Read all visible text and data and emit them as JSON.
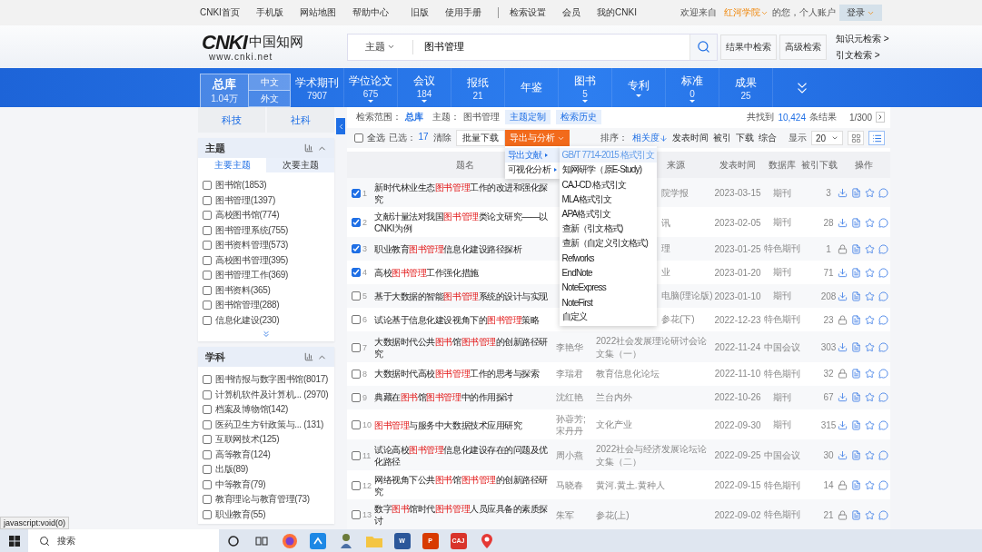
{
  "top_links": {
    "left": [
      "CNKI首页",
      "手机版",
      "网站地图",
      "帮助中心"
    ],
    "right": [
      "旧版",
      "使用手册",
      "检索设置",
      "会员",
      "我的CNKI"
    ],
    "welcome": "欢迎来自",
    "org": "红河学院",
    "greeting": "的您，个人账户",
    "login": "登录"
  },
  "header": {
    "logo": {
      "mark": "CNKI",
      "name": "中国知网",
      "url": "www.cnki.net"
    },
    "field_select": "主题",
    "query": "图书管理",
    "buttons": [
      "结果中检索",
      "高级检索"
    ],
    "links": [
      "知识元检索 >",
      "引文检索 >"
    ]
  },
  "nav": {
    "main": {
      "label": "总库",
      "count": "1.04万",
      "selected": true
    },
    "lang": [
      {
        "label": "中文",
        "selected": true
      },
      {
        "label": "外文",
        "selected": false
      }
    ],
    "tabs": [
      {
        "label": "学术期刊",
        "count": "7907",
        "dropdown": false
      },
      {
        "label": "学位论文",
        "count": "675",
        "dropdown": true
      },
      {
        "label": "会议",
        "count": "184",
        "dropdown": true
      },
      {
        "label": "报纸",
        "count": "21",
        "dropdown": false
      },
      {
        "label": "年鉴",
        "dropdown": false
      },
      {
        "label": "图书",
        "count": "5",
        "dropdown": true
      },
      {
        "label": "专利",
        "dropdown": true
      },
      {
        "label": "标准",
        "count": "0",
        "dropdown": true
      },
      {
        "label": "成果",
        "count": "25",
        "dropdown": false
      }
    ]
  },
  "sidebar": {
    "domains": [
      "科技",
      "社科"
    ],
    "panels": [
      {
        "title": "主题",
        "subtabs": [
          {
            "label": "主要主题",
            "selected": true
          },
          {
            "label": "次要主题",
            "selected": false
          }
        ],
        "more": true,
        "items": [
          {
            "label": "图书馆(1853)",
            "checked": false
          },
          {
            "label": "图书管理(1397)",
            "checked": false
          },
          {
            "label": "高校图书馆(774)",
            "checked": false
          },
          {
            "label": "图书管理系统(755)",
            "checked": false
          },
          {
            "label": "图书资料管理(573)",
            "checked": false
          },
          {
            "label": "高校图书管理(395)",
            "checked": false
          },
          {
            "label": "图书管理工作(369)",
            "checked": false
          },
          {
            "label": "图书资料(365)",
            "checked": false
          },
          {
            "label": "图书馆管理(288)",
            "checked": false
          },
          {
            "label": "信息化建设(230)",
            "checked": false
          }
        ]
      },
      {
        "title": "学科",
        "more": false,
        "items": [
          {
            "label": "图书情报与数字图书馆(8017)",
            "checked": false
          },
          {
            "label": "计算机软件及计算机...  (2970)",
            "checked": false
          },
          {
            "label": "档案及博物馆(142)",
            "checked": false
          },
          {
            "label": "医药卫生方针政策与...  (131)",
            "checked": false
          },
          {
            "label": "互联网技术(125)",
            "checked": false
          },
          {
            "label": "高等教育(124)",
            "checked": false
          },
          {
            "label": "出版(89)",
            "checked": false
          },
          {
            "label": "中等教育(79)",
            "checked": false
          },
          {
            "label": "教育理论与教育管理(73)",
            "checked": false
          },
          {
            "label": "职业教育(55)",
            "checked": false
          }
        ]
      }
    ]
  },
  "scope": {
    "label": "检索范围：",
    "value": "总库",
    "topic_label": "主题：",
    "topic": "图书管理",
    "buttons": [
      "主题定制",
      "检索历史"
    ],
    "found": "共找到",
    "total": "10,424",
    "unit": "条结果",
    "page": "1/300"
  },
  "toolbar": {
    "select_all": {
      "label": "全选",
      "checked": false
    },
    "selected_label": "已选：",
    "selected_count": "17",
    "clear": "清除",
    "batch": "批量下载",
    "export": "导出与分析",
    "sort_label": "排序：",
    "sorts": [
      {
        "label": "相关度",
        "selected": true
      },
      {
        "label": "发表时间",
        "selected": false
      },
      {
        "label": "被引",
        "selected": false
      },
      {
        "label": "下载",
        "selected": false
      },
      {
        "label": "综合",
        "selected": false
      }
    ],
    "show_label": "显示",
    "page_size": "20",
    "views": [
      {
        "kind": "grid",
        "selected": false
      },
      {
        "kind": "list",
        "selected": true
      }
    ]
  },
  "export_menu": {
    "groups": [
      {
        "label": "导出文献",
        "selected": true
      },
      {
        "label": "可视化分析",
        "selected": false
      }
    ],
    "formats": [
      {
        "label": "GB/T 7714-2015 格式引文",
        "selected": true
      },
      {
        "label": "知网研学（原E-Study)",
        "selected": false
      },
      {
        "label": "CAJ-CD 格式引文",
        "selected": false
      },
      {
        "label": "MLA格式引文",
        "selected": false
      },
      {
        "label": "APA格式引文",
        "selected": false
      },
      {
        "label": "查新（引文格式)",
        "selected": false
      },
      {
        "label": "查新（自定义引文格式)",
        "selected": false
      },
      {
        "label": "Refworks",
        "selected": false
      },
      {
        "label": "EndNote",
        "selected": false
      },
      {
        "label": "NoteExpress",
        "selected": false
      },
      {
        "label": "NoteFirst",
        "selected": false
      },
      {
        "label": "自定义",
        "selected": false
      }
    ]
  },
  "table": {
    "columns": [
      "题名",
      "来源",
      "发表时间",
      "数据库",
      "被引",
      "下载",
      "操作"
    ],
    "rows": [
      {
        "num": "1",
        "checked": true,
        "title": [
          {
            "text": "新时代林业生态",
            "hit": false
          },
          {
            "text": "图书管理",
            "hit": true
          },
          {
            "text": "工作的改进和强化探究",
            "hit": false
          }
        ],
        "source": "院学报",
        "date": "2023-03-15",
        "db": "期刊",
        "downloads": "3",
        "locked": false
      },
      {
        "num": "2",
        "checked": true,
        "title": [
          {
            "text": "文献计量法对我国",
            "hit": false
          },
          {
            "text": "图书管理",
            "hit": true
          },
          {
            "text": "类论文研究——以CNKI为例",
            "hit": false
          }
        ],
        "source": "讯",
        "date": "2023-02-05",
        "db": "期刊",
        "downloads": "28",
        "locked": false
      },
      {
        "num": "3",
        "checked": true,
        "title": [
          {
            "text": "职业教育",
            "hit": false
          },
          {
            "text": "图书管理",
            "hit": true
          },
          {
            "text": "信息化建设路径探析",
            "hit": false
          }
        ],
        "source": "理",
        "date": "2023-01-25",
        "db": "特色期刊",
        "downloads": "1",
        "locked": true
      },
      {
        "num": "4",
        "checked": true,
        "title": [
          {
            "text": "高校",
            "hit": false
          },
          {
            "text": "图书管理",
            "hit": true
          },
          {
            "text": "工作强化措施",
            "hit": false
          }
        ],
        "source": "业",
        "date": "2023-01-20",
        "db": "期刊",
        "downloads": "71",
        "locked": false
      },
      {
        "num": "5",
        "checked": false,
        "title": [
          {
            "text": "基于大数据的智能",
            "hit": false
          },
          {
            "text": "图书管理",
            "hit": true
          },
          {
            "text": "系统的设计与实现",
            "hit": false
          }
        ],
        "source": "电脑(理论版)",
        "date": "2023-01-10",
        "db": "期刊",
        "downloads": "208",
        "locked": false
      },
      {
        "num": "6",
        "checked": false,
        "title": [
          {
            "text": "试论基于信息化建设视角下的",
            "hit": false
          },
          {
            "text": "图书管理",
            "hit": true
          },
          {
            "text": "策略",
            "hit": false
          }
        ],
        "source": "参花(下)",
        "date": "2022-12-23",
        "db": "特色期刊",
        "downloads": "23",
        "locked": true
      },
      {
        "num": "7",
        "checked": false,
        "title": [
          {
            "text": "大数据时代公共",
            "hit": false
          },
          {
            "text": "图书",
            "hit": true
          },
          {
            "text": "馆",
            "hit": false
          },
          {
            "text": "图书管理",
            "hit": true
          },
          {
            "text": "的创新路径研究",
            "hit": false
          }
        ],
        "author": "李艳华",
        "source": "2022社会发展理论研讨会论文集（一）",
        "date": "2022-11-24",
        "db": "中国会议",
        "downloads": "303",
        "locked": false
      },
      {
        "num": "8",
        "checked": false,
        "title": [
          {
            "text": "大数据时代高校",
            "hit": false
          },
          {
            "text": "图书管理",
            "hit": true
          },
          {
            "text": "工作的思考与探索",
            "hit": false
          }
        ],
        "author": "李瑞君",
        "source": "教育信息化论坛",
        "date": "2022-11-10",
        "db": "特色期刊",
        "downloads": "32",
        "locked": true
      },
      {
        "num": "9",
        "checked": false,
        "title": [
          {
            "text": "典藏在",
            "hit": false
          },
          {
            "text": "图书",
            "hit": true
          },
          {
            "text": "馆",
            "hit": false
          },
          {
            "text": "图书管理",
            "hit": true
          },
          {
            "text": "中的作用探讨",
            "hit": false
          }
        ],
        "author": "沈红艳",
        "source": "兰台内外",
        "date": "2022-10-26",
        "db": "期刊",
        "downloads": "67",
        "locked": false
      },
      {
        "num": "10",
        "checked": false,
        "title": [
          {
            "text": "图书管理",
            "hit": true
          },
          {
            "text": "与服务中大数据技术应用研究",
            "hit": false
          }
        ],
        "author": "孙蓉芳; 宋丹丹",
        "source": "文化产业",
        "date": "2022-09-30",
        "db": "期刊",
        "downloads": "315",
        "locked": false
      },
      {
        "num": "11",
        "checked": false,
        "title": [
          {
            "text": "试论高校",
            "hit": false
          },
          {
            "text": "图书管理",
            "hit": true
          },
          {
            "text": "信息化建设存在的问题及优化路径",
            "hit": false
          }
        ],
        "author": "周小燕",
        "source": "2022社会与经济发展论坛论文集（二）",
        "date": "2022-09-25",
        "db": "中国会议",
        "downloads": "30",
        "locked": false
      },
      {
        "num": "12",
        "checked": false,
        "title": [
          {
            "text": "网络视角下公共",
            "hit": false
          },
          {
            "text": "图书",
            "hit": true
          },
          {
            "text": "馆",
            "hit": false
          },
          {
            "text": "图书管理",
            "hit": true
          },
          {
            "text": "的创新路径研究",
            "hit": false
          }
        ],
        "author": "马晓春",
        "source": "黄河.黄土.黄种人",
        "date": "2022-09-15",
        "db": "特色期刊",
        "downloads": "14",
        "locked": true
      },
      {
        "num": "13",
        "checked": false,
        "title": [
          {
            "text": "数字",
            "hit": false
          },
          {
            "text": "图书",
            "hit": true
          },
          {
            "text": "馆时代",
            "hit": false
          },
          {
            "text": "图书管理",
            "hit": true
          },
          {
            "text": "人员应具备的素质探讨",
            "hit": false
          }
        ],
        "author": "朱军",
        "source": "参花(上)",
        "date": "2022-09-02",
        "db": "特色期刊",
        "downloads": "21",
        "locked": true
      }
    ]
  },
  "status_tip": "javascript:void(0)",
  "taskbar": {
    "search": "搜索",
    "apps": [
      {
        "kind": "firefox"
      },
      {
        "kind": "blue"
      },
      {
        "kind": "figure"
      },
      {
        "kind": "folder"
      },
      {
        "kind": "letter",
        "label": "W",
        "color": "#2b579a"
      },
      {
        "kind": "letter",
        "label": "P",
        "color": "#d83b01"
      },
      {
        "kind": "letter",
        "label": "CAJ",
        "color": "#d9342b"
      },
      {
        "kind": "pin"
      }
    ]
  }
}
